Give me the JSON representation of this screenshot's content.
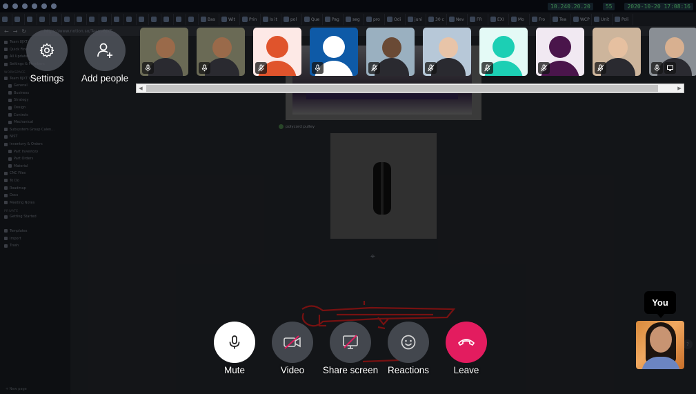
{
  "os_bar": {
    "ip": "10.240.20.20",
    "volume": "55",
    "datetime": "2020-10-20 17:08:16"
  },
  "browser": {
    "tabs": [
      "",
      "",
      "",
      "",
      "",
      "",
      "",
      "",
      "",
      "",
      "",
      "",
      "",
      "",
      "",
      "",
      "Bas",
      "Wit",
      "Prin",
      "Is it",
      "pol",
      "Que",
      "Pag",
      "seg",
      "pro",
      "Odi",
      "juni",
      "30 c",
      "Nev",
      "FR",
      "EXI",
      "Mo",
      "Fro",
      "Tea",
      "WCP",
      "Unit",
      "Poli"
    ],
    "url": "https://www.notion.so/Team-8JXT..."
  },
  "notion": {
    "sidebar": [
      {
        "label": "Team 8JXT",
        "level": 0
      },
      {
        "label": "Quick Find",
        "level": 0
      },
      {
        "label": "All Updates",
        "level": 0
      },
      {
        "label": "Settings & Members",
        "level": 0
      },
      {
        "label": "WORKSPACE",
        "level": -1
      },
      {
        "label": "Team 8JXT Wiki",
        "level": 0
      },
      {
        "label": "General",
        "level": 1
      },
      {
        "label": "Business",
        "level": 1
      },
      {
        "label": "Strategy",
        "level": 1
      },
      {
        "label": "Design",
        "level": 1
      },
      {
        "label": "Controls",
        "level": 1
      },
      {
        "label": "Mechanical",
        "level": 1
      },
      {
        "label": "Subsystem Group Calen...",
        "level": 0
      },
      {
        "label": "NIST",
        "level": 0
      },
      {
        "label": "Inventory & Orders",
        "level": 0
      },
      {
        "label": "Part Inventory",
        "level": 1
      },
      {
        "label": "Part Orders",
        "level": 1
      },
      {
        "label": "Material",
        "level": 1
      },
      {
        "label": "CNC Files",
        "level": 0
      },
      {
        "label": "To Do",
        "level": 0
      },
      {
        "label": "Roadmap",
        "level": 0
      },
      {
        "label": "Docs",
        "level": 0
      },
      {
        "label": "Meeting Notes",
        "level": 0
      },
      {
        "label": "PRIVATE",
        "level": -1
      },
      {
        "label": "Getting Started",
        "level": 0
      },
      {
        "label": "",
        "level": -1
      },
      {
        "label": "Templates",
        "level": 0
      },
      {
        "label": "Import",
        "level": 0
      },
      {
        "label": "Trash",
        "level": 0
      }
    ],
    "new_page": "+ New page",
    "caption": "polycord pulley",
    "help": "?"
  },
  "call": {
    "settings_label": "Settings",
    "add_people_label": "Add people",
    "participants": [
      {
        "type": "photo",
        "mic": "on",
        "skin": "#9a6a4a",
        "bg": "#6a6a55"
      },
      {
        "type": "photo",
        "mic": "on",
        "skin": "#9a6a4a",
        "bg": "#6a6a55"
      },
      {
        "type": "avatar",
        "mic": "muted",
        "color": "#e0542c",
        "bg": "#fde9e6"
      },
      {
        "type": "avatar",
        "mic": "on",
        "color": "#ffffff",
        "bg": "#0e5aa7"
      },
      {
        "type": "photo",
        "mic": "muted",
        "skin": "#6a4a35",
        "bg": "#9ab0c0"
      },
      {
        "type": "photo",
        "mic": "muted",
        "skin": "#e8c4a8",
        "bg": "#b7c8d8"
      },
      {
        "type": "avatar",
        "mic": "muted",
        "color": "#1ccfb4",
        "bg": "#e4faf6"
      },
      {
        "type": "avatar",
        "mic": "muted",
        "color": "#4a154b",
        "bg": "#f1e9f2"
      },
      {
        "type": "photo",
        "mic": "muted",
        "skin": "#e6c0a0",
        "bg": "#cdb59c"
      },
      {
        "type": "photo",
        "mic": "on",
        "skin": "#d8b090",
        "bg": "#8a8f95",
        "screen": true
      }
    ],
    "controls": {
      "mute": "Mute",
      "video": "Video",
      "share": "Share screen",
      "reactions": "Reactions",
      "leave": "Leave"
    },
    "self_label": "You",
    "colors": {
      "leave": "#e31c5f",
      "mute_bg": "#ffffff",
      "control_gray": "#484c54"
    }
  }
}
